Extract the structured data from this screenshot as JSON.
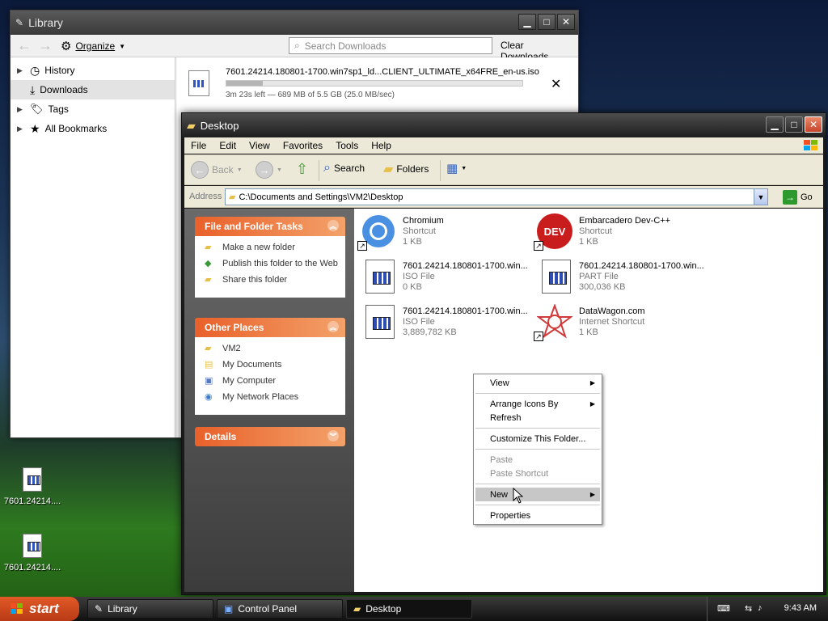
{
  "desktop": {
    "icons": [
      {
        "label": "7601.24214...."
      },
      {
        "label": "7601.24214...."
      }
    ]
  },
  "library": {
    "title": "Library",
    "organize_label": "Organize",
    "search_placeholder": "Search Downloads",
    "clear_label": "Clear Downloads",
    "sidebar": [
      {
        "label": "History",
        "icon": "clock-icon"
      },
      {
        "label": "Downloads",
        "icon": "download-icon"
      },
      {
        "label": "Tags",
        "icon": "tag-icon"
      },
      {
        "label": "All Bookmarks",
        "icon": "star-icon"
      }
    ],
    "download": {
      "name": "7601.24214.180801-1700.win7sp1_ld...CLIENT_ULTIMATE_x64FRE_en-us.iso",
      "status": "3m 23s left — 689 MB of 5.5 GB (25.0 MB/sec)",
      "progress": 0.122
    }
  },
  "explorer": {
    "title": "Desktop",
    "menu": [
      "File",
      "Edit",
      "View",
      "Favorites",
      "Tools",
      "Help"
    ],
    "toolbar": {
      "back": "Back",
      "search": "Search",
      "folders": "Folders"
    },
    "address_label": "Address",
    "address_value": "C:\\Documents and Settings\\VM2\\Desktop",
    "go_label": "Go",
    "tasks": {
      "file_folder": {
        "title": "File and Folder Tasks",
        "links": [
          "Make a new folder",
          "Publish this folder to the Web",
          "Share this folder"
        ]
      },
      "other_places": {
        "title": "Other Places",
        "links": [
          "VM2",
          "My Documents",
          "My Computer",
          "My Network Places"
        ]
      },
      "details": {
        "title": "Details"
      }
    },
    "files": [
      {
        "name": "Chromium",
        "type": "Shortcut",
        "size": "1 KB"
      },
      {
        "name": "Embarcadero Dev-C++",
        "type": "Shortcut",
        "size": "1 KB"
      },
      {
        "name": "7601.24214.180801-1700.win...",
        "type": "ISO File",
        "size": "0 KB"
      },
      {
        "name": "7601.24214.180801-1700.win...",
        "type": "PART File",
        "size": "300,036 KB"
      },
      {
        "name": "7601.24214.180801-1700.win...",
        "type": "ISO File",
        "size": "3,889,782 KB"
      },
      {
        "name": "DataWagon.com",
        "type": "Internet Shortcut",
        "size": "1 KB"
      }
    ],
    "dev_icon_text": "DEV",
    "context_menu": {
      "view": "View",
      "arrange": "Arrange Icons By",
      "refresh": "Refresh",
      "customize": "Customize This Folder...",
      "paste": "Paste",
      "paste_shortcut": "Paste Shortcut",
      "new": "New",
      "properties": "Properties"
    }
  },
  "taskbar": {
    "start_label": "start",
    "tasks": [
      "Library",
      "Control Panel",
      "Desktop"
    ],
    "clock": "9:43 AM"
  }
}
